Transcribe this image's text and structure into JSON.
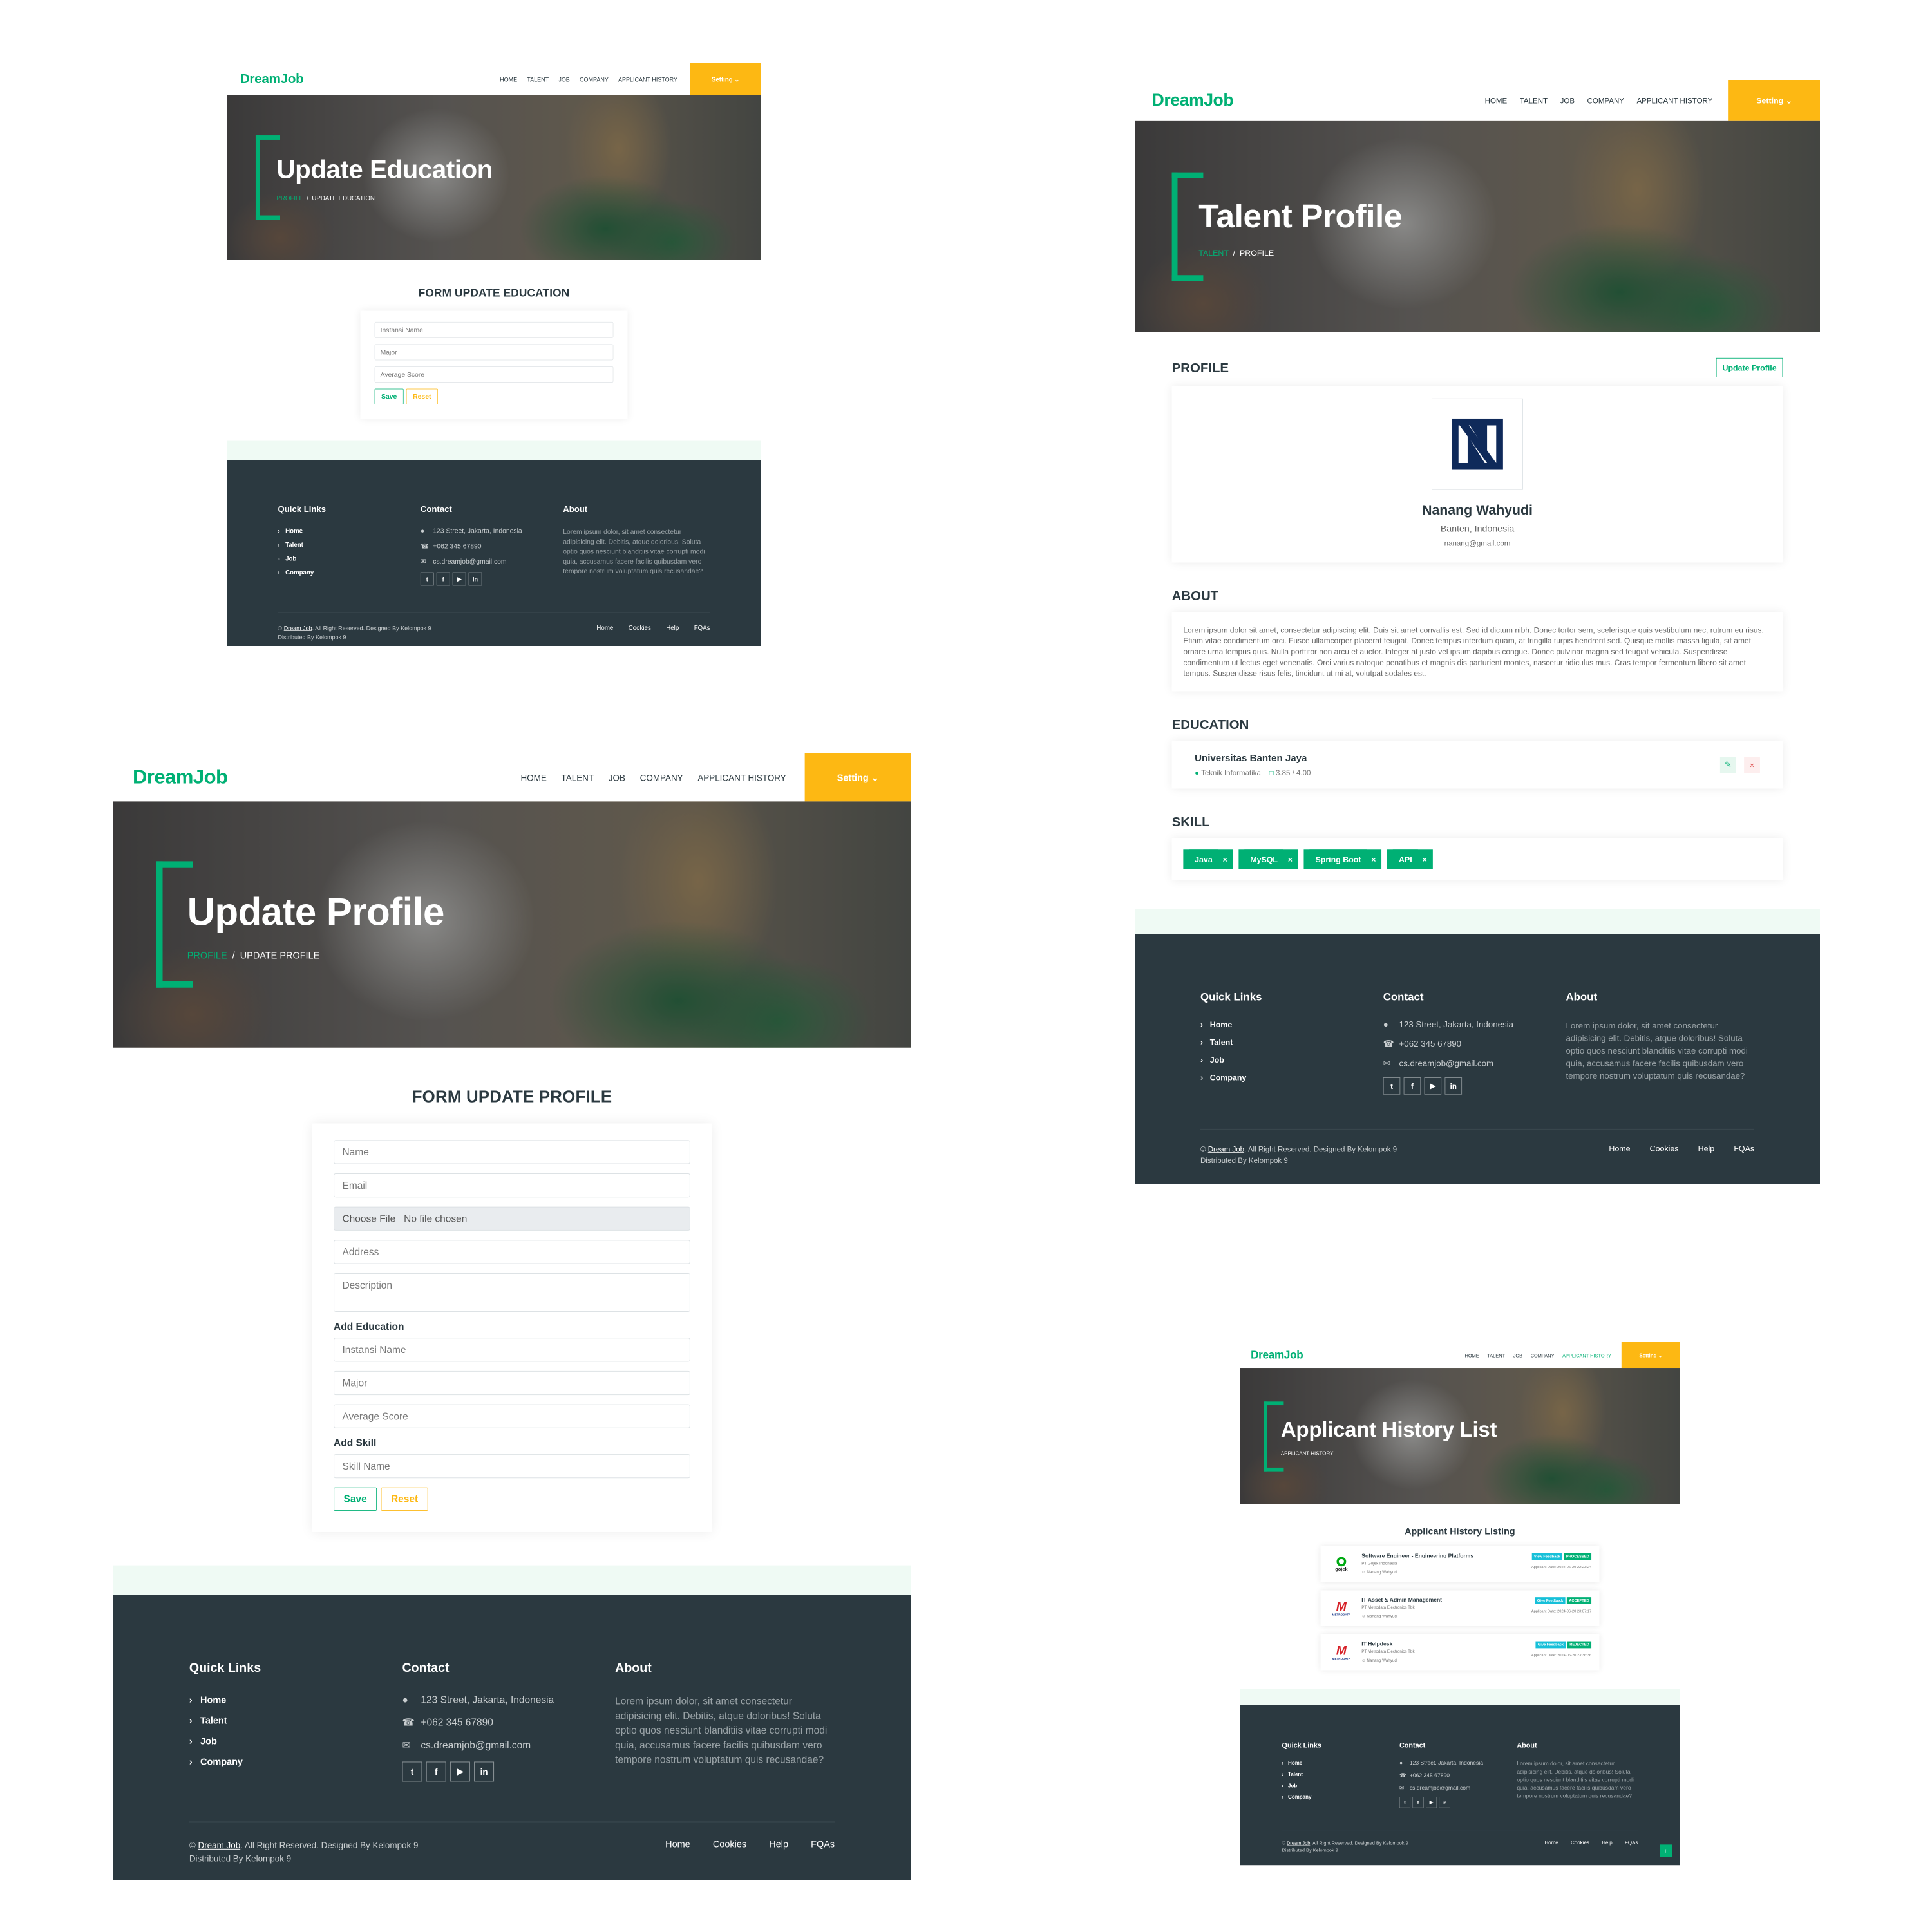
{
  "brand": "DreamJob",
  "nav": {
    "items": [
      "HOME",
      "TALENT",
      "JOB",
      "COMPANY",
      "APPLICANT HISTORY"
    ],
    "setting": "Setting",
    "setting_icon": "chevron-down-icon"
  },
  "footer": {
    "quick_title": "Quick Links",
    "quick_links": [
      "Home",
      "Talent",
      "Job",
      "Company"
    ],
    "contact_title": "Contact",
    "address": "123 Street, Jakarta, Indonesia",
    "phone": "+062 345 67890",
    "email": "cs.dreamjob@gmail.com",
    "social": [
      "twitter-icon",
      "facebook-icon",
      "youtube-icon",
      "linkedin-icon"
    ],
    "about_title": "About",
    "about_text": "Lorem ipsum dolor, sit amet consectetur adipisicing elit. Debitis, atque doloribus! Soluta optio quos nesciunt blanditiis vitae corrupti modi quia, accusamus facere facilis quibusdam vero tempore nostrum voluptatum quis recusandae?",
    "copy_prefix": "©",
    "copy_link": "Dream Job",
    "copy_suffix": ". All Right Reserved. Designed By Kelompok 9",
    "distributed": "Distributed By Kelompok 9",
    "links": [
      "Home",
      "Cookies",
      "Help",
      "FQAs"
    ]
  },
  "colors": {
    "accent": "#00b074",
    "setting": "#fdb813",
    "footer": "#2b3940"
  },
  "education_page": {
    "title": "Update Education",
    "crumb_link": "PROFILE",
    "crumb_current": "UPDATE EDUCATION",
    "form_title": "FORM UPDATE EDUCATION",
    "placeholders": [
      "Instansi Name",
      "Major",
      "Average Score"
    ],
    "save": "Save",
    "reset": "Reset"
  },
  "profile_page": {
    "title": "Update Profile",
    "crumb_link": "PROFILE",
    "crumb_current": "UPDATE PROFILE",
    "form_title": "FORM UPDATE PROFILE",
    "fields": [
      "Name",
      "Email"
    ],
    "file_button": "Choose File",
    "file_text": "No file chosen",
    "address": "Address",
    "description": "Description",
    "add_education": "Add Education",
    "edu_fields": [
      "Instansi Name",
      "Major",
      "Average Score"
    ],
    "add_skill": "Add Skill",
    "skill_field": "Skill Name",
    "save": "Save",
    "reset": "Reset"
  },
  "talent_page": {
    "title": "Talent Profile",
    "crumb_link": "TALENT",
    "crumb_current": "PROFILE",
    "profile_heading": "PROFILE",
    "update_button": "Update Profile",
    "name": "Nanang Wahyudi",
    "location": "Banten, Indonesia",
    "email": "nanang@gmail.com",
    "about_heading": "ABOUT",
    "about_text": "Lorem ipsum dolor sit amet, consectetur adipiscing elit. Duis sit amet convallis est. Sed id dictum nibh. Donec tortor sem, scelerisque quis vestibulum nec, rutrum eu risus. Etiam vitae condimentum orci. Fusce ullamcorper placerat feugiat. Donec tempus interdum quam, at fringilla turpis hendrerit sed. Quisque mollis massa ligula, sit amet ornare urna tempus quis. Nulla porttitor non arcu et auctor. Integer at justo vel ipsum dapibus congue. Donec pulvinar magna sed feugiat vehicula. Suspendisse condimentum ut lectus eget venenatis. Orci varius natoque penatibus et magnis dis parturient montes, nascetur ridiculus mus. Cras tempor fermentum libero sit amet tempus. Suspendisse risus felis, tincidunt ut mi at, volutpat sodales est.",
    "education_heading": "EDUCATION",
    "education": {
      "school": "Universitas Banten Jaya",
      "major": "Teknik Informatika",
      "score": "3.85 / 4.00"
    },
    "skill_heading": "SKILL",
    "skills": [
      "Java",
      "MySQL",
      "Spring Boot",
      "API"
    ]
  },
  "history_page": {
    "title": "Applicant History List",
    "crumb": "APPLICANT HISTORY",
    "heading": "Applicant History Listing",
    "items": [
      {
        "logo": "gojek",
        "title": "Software Engineer - Engineering Platforms",
        "company": "PT Gojek Indonesia",
        "user": "Nanang Wahyudi",
        "feedback": "View Feedback",
        "status": "PROCESSED",
        "date": "Applicant Date: 2024-06-20 22:23:24"
      },
      {
        "logo": "METRODATA",
        "title": "IT Asset & Admin Management",
        "company": "PT Metrodata Electronics Tbk",
        "user": "Nanang Wahyudi",
        "feedback": "Give Feedback",
        "status": "ACCEPTED",
        "date": "Applicant Date: 2024-06-20 23:07:17"
      },
      {
        "logo": "METRODATA",
        "title": "IT Helpdesk",
        "company": "PT Metrodata Electronics Tbk",
        "user": "Nanang Wahyudi",
        "feedback": "Give Feedback",
        "status": "REJECTED",
        "date": "Applicant Date: 2024-06-20 23:36:36"
      }
    ]
  }
}
